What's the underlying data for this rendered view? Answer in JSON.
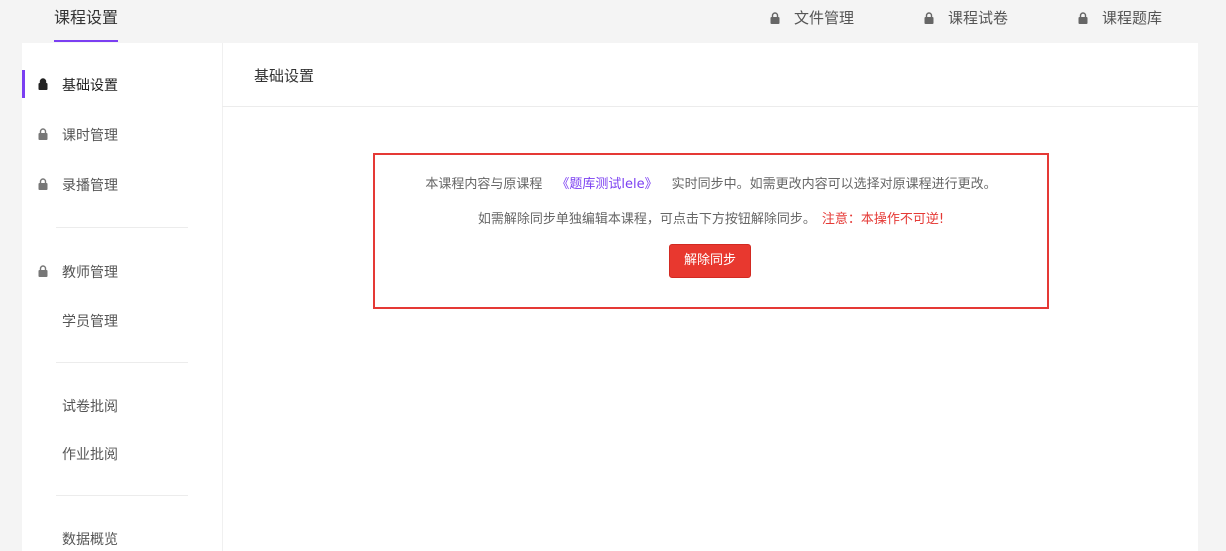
{
  "topbar": {
    "active_tab": "课程设置",
    "links": [
      {
        "label": "文件管理"
      },
      {
        "label": "课程试卷"
      },
      {
        "label": "课程题库"
      }
    ]
  },
  "sidebar": {
    "items": [
      {
        "label": "基础设置",
        "locked": true,
        "active": true
      },
      {
        "label": "课时管理",
        "locked": true
      },
      {
        "label": "录播管理",
        "locked": true
      },
      {
        "label": "教师管理",
        "locked": true
      },
      {
        "label": "学员管理",
        "locked": false
      },
      {
        "label": "试卷批阅",
        "locked": false
      },
      {
        "label": "作业批阅",
        "locked": false
      },
      {
        "label": "数据概览",
        "locked": false
      }
    ]
  },
  "content": {
    "title": "基础设置",
    "notice": {
      "line1_prefix": "本课程内容与原课程",
      "course_name": "《题库测试lele》",
      "line1_suffix": "实时同步中。如需更改内容可以选择对原课程进行更改。",
      "line2_text": "如需解除同步单独编辑本课程，可点击下方按钮解除同步。",
      "line2_warning": "注意：本操作不可逆!",
      "button_label": "解除同步"
    }
  },
  "colors": {
    "accent": "#7b3ff2",
    "danger": "#e53935"
  }
}
